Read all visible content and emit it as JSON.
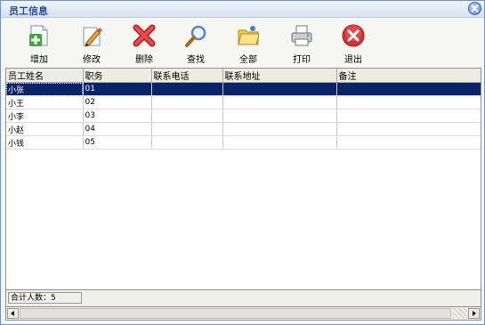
{
  "window": {
    "title": "员工信息"
  },
  "toolbar": {
    "items": [
      {
        "label": "增加",
        "icon": "add-doc-icon"
      },
      {
        "label": "修改",
        "icon": "edit-icon"
      },
      {
        "label": "删除",
        "icon": "delete-icon"
      },
      {
        "label": "查找",
        "icon": "search-icon"
      },
      {
        "label": "全部",
        "icon": "folder-icon"
      },
      {
        "label": "打印",
        "icon": "printer-icon"
      },
      {
        "label": "退出",
        "icon": "exit-icon"
      }
    ]
  },
  "table": {
    "columns": [
      "员工姓名",
      "职务",
      "联系电话",
      "联系地址",
      "备注"
    ],
    "rows": [
      [
        "小张",
        "01",
        "",
        "",
        ""
      ],
      [
        "小王",
        "02",
        "",
        "",
        ""
      ],
      [
        "小李",
        "03",
        "",
        "",
        ""
      ],
      [
        "小赵",
        "04",
        "",
        "",
        ""
      ],
      [
        "小钱",
        "05",
        "",
        "",
        ""
      ]
    ],
    "selected_row": 0
  },
  "status": {
    "count_text": "合计人数：5"
  },
  "colors": {
    "selection": "#0a246a",
    "title_text": "#2a4f8f"
  }
}
